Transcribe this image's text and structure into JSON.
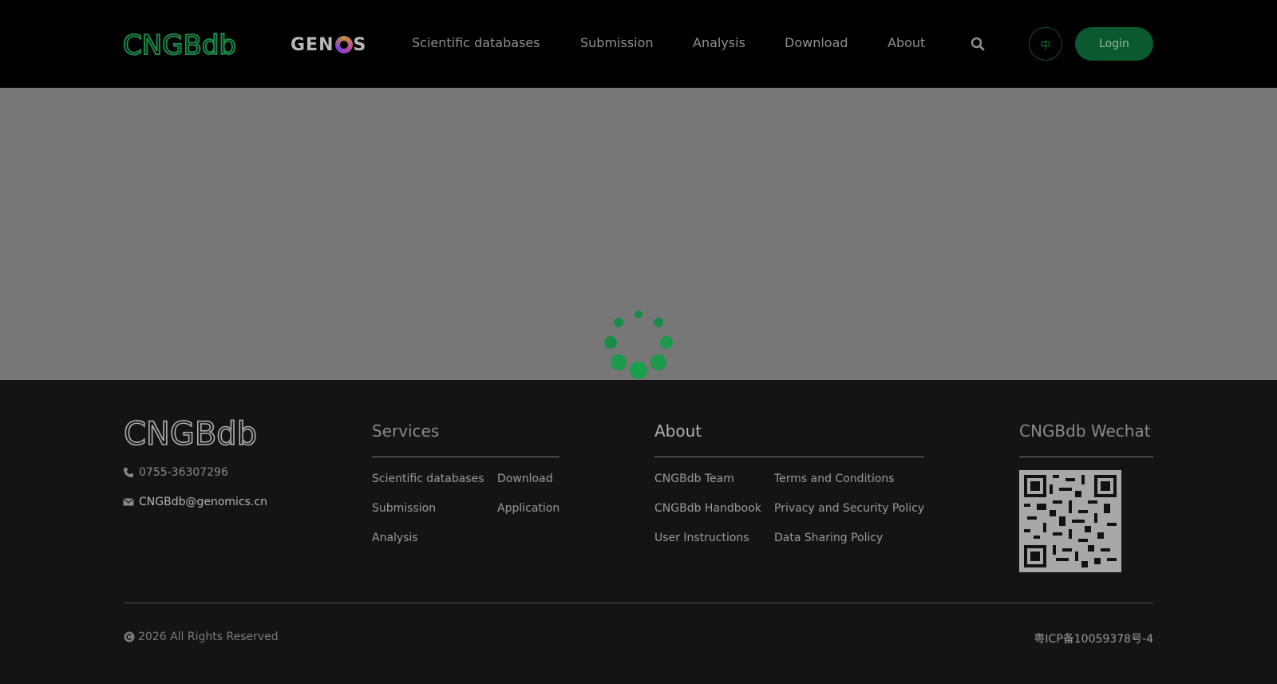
{
  "header": {
    "logo_text": "CNGBdb",
    "genos_logo": "GENOS",
    "nav": [
      "Scientific databases",
      "Submission",
      "Analysis",
      "Download",
      "About"
    ],
    "lang_label": "中",
    "login_label": "Login",
    "search_icon": "search-icon"
  },
  "colors": {
    "brand_green": "#0b5a2f",
    "spinner_green": "#1a9a4a",
    "overlay_gray": "#777777"
  },
  "footer": {
    "logo_text": "CNGBdb",
    "phone": "0755-36307296",
    "email": "CNGBdb@genomics.cn",
    "services": {
      "heading": "Services",
      "links": [
        "Scientific databases",
        "Download",
        "Submission",
        "Application",
        "Analysis"
      ]
    },
    "about": {
      "heading": "About",
      "links": [
        "CNGBdb Team",
        "Terms and Conditions",
        "CNGBdb Handbook",
        "Privacy and Security Policy",
        "User Instructions",
        "Data Sharing Policy"
      ]
    },
    "wechat": {
      "heading": "CNGBdb Wechat"
    },
    "copyright": "2026 All Rights Reserved",
    "icp": "粤ICP备10059378号-4"
  }
}
